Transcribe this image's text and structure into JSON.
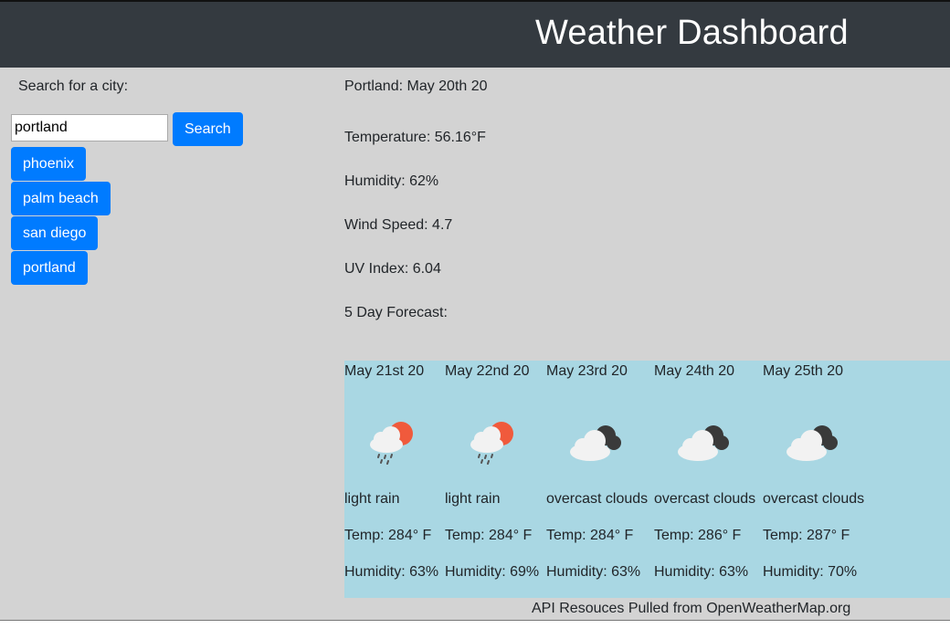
{
  "header": {
    "title": "Weather Dashboard"
  },
  "search": {
    "label": "Search for a city:",
    "value": "portland",
    "button_label": "Search"
  },
  "history": [
    "phoenix",
    "palm beach",
    "san diego",
    "portland"
  ],
  "current": {
    "title": "Portland: May 20th 20",
    "temperature": "Temperature: 56.16°F",
    "humidity": "Humidity: 62%",
    "wind": "Wind Speed: 4.7",
    "uv": "UV Index: 6.04",
    "forecast_label": "5 Day Forecast:"
  },
  "forecast": [
    {
      "date": "May 21st 20",
      "icon": "rain-cloud-sun-icon",
      "desc": "light rain",
      "temp": "Temp: 284° F",
      "humidity": "Humidity: 63%"
    },
    {
      "date": "May 22nd 20",
      "icon": "rain-cloud-sun-icon",
      "desc": "light rain",
      "temp": "Temp: 284° F",
      "humidity": "Humidity: 69%"
    },
    {
      "date": "May 23rd 20",
      "icon": "overcast-clouds-icon",
      "desc": "overcast clouds",
      "temp": "Temp: 284° F",
      "humidity": "Humidity: 63%"
    },
    {
      "date": "May 24th 20",
      "icon": "overcast-clouds-icon",
      "desc": "overcast clouds",
      "temp": "Temp: 286° F",
      "humidity": "Humidity: 63%"
    },
    {
      "date": "May 25th 20",
      "icon": "overcast-clouds-icon",
      "desc": "overcast clouds",
      "temp": "Temp: 287° F",
      "humidity": "Humidity: 70%"
    }
  ],
  "footer": {
    "text": "API Resouces Pulled from OpenWeatherMap.org"
  },
  "colors": {
    "header_bg": "#343a40",
    "button": "#007bff",
    "forecast_bg": "#a9d7e3",
    "page_bg": "#d3d3d3"
  }
}
